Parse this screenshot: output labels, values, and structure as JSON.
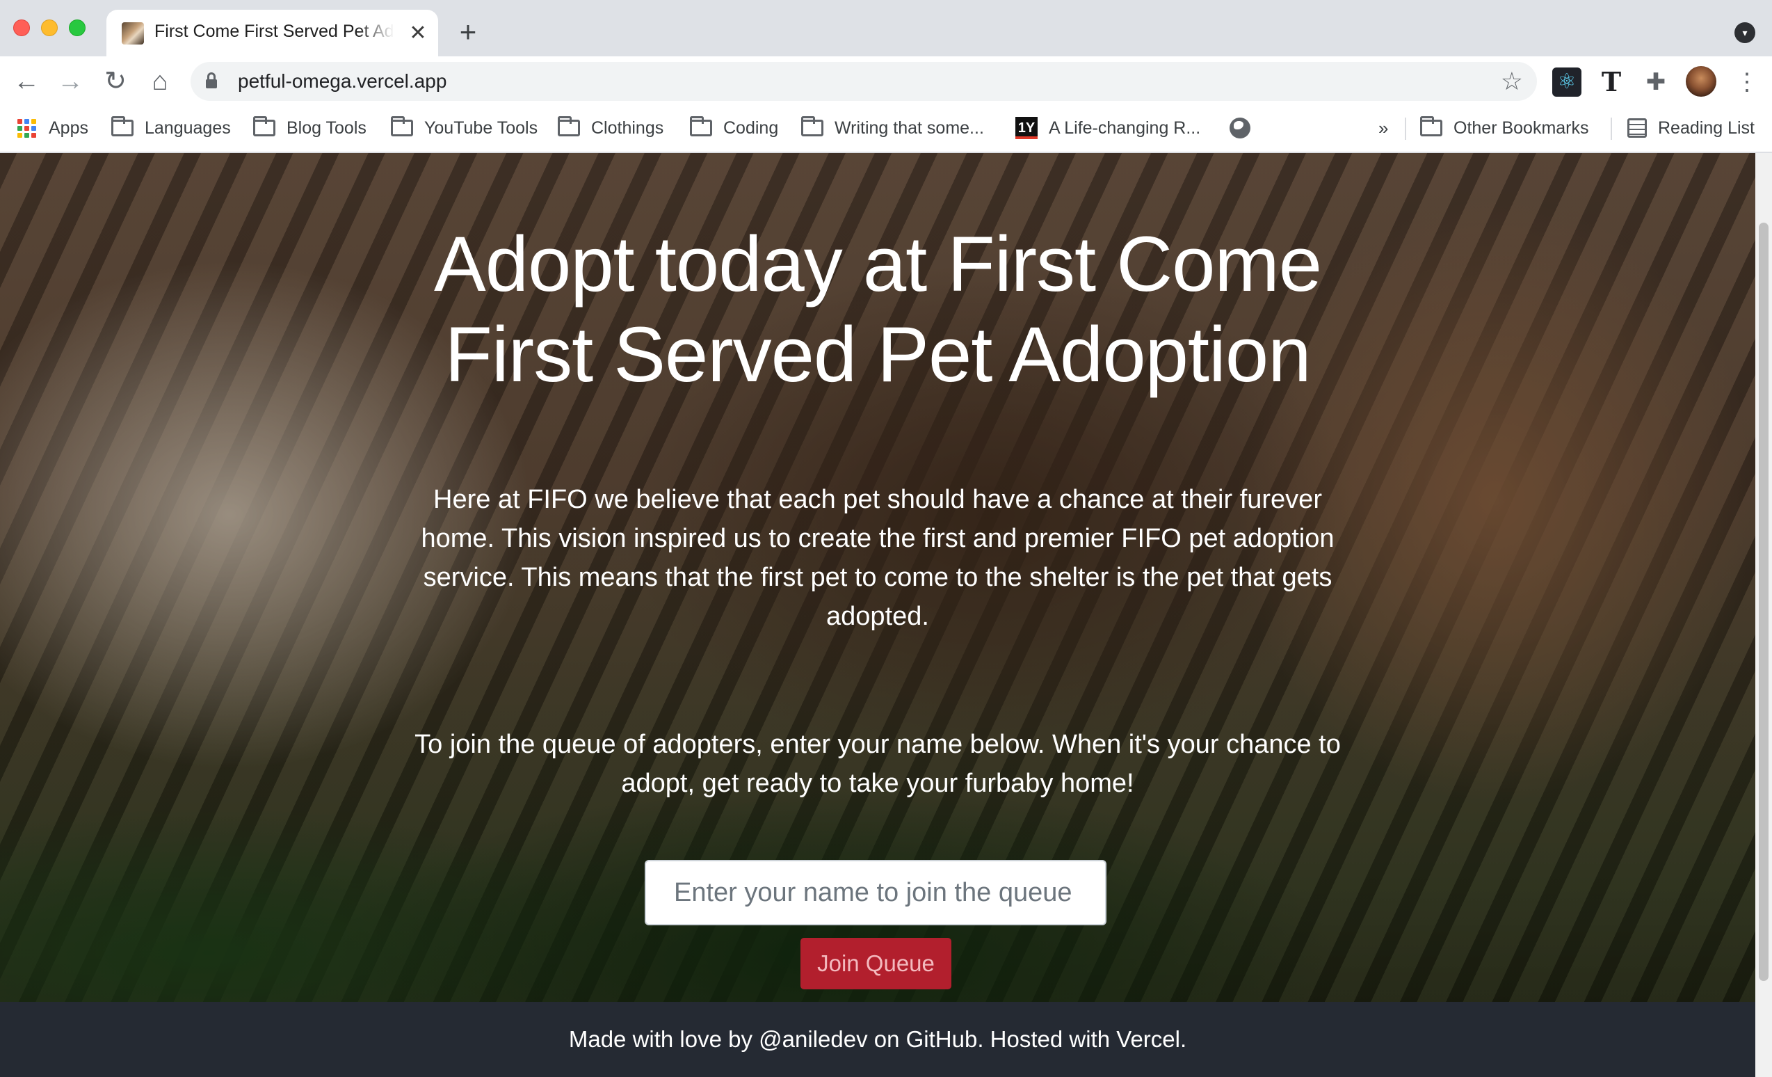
{
  "browser": {
    "tab": {
      "title": "First Come First Served Pet Adoption",
      "close_glyph": "✕"
    },
    "new_tab_glyph": "+",
    "nav": {
      "back_glyph": "←",
      "forward_glyph": "→",
      "reload_glyph": "↻",
      "home_glyph": "⌂"
    },
    "address_bar": {
      "url": "petful-omega.vercel.app",
      "bookmark_star_glyph": "☆"
    },
    "extensions": {
      "react_glyph": "⚛",
      "text_glyph": "T",
      "puzzle_glyph": "✚"
    },
    "menu_glyph": "⋮",
    "bookmarks": {
      "apps_label": "Apps",
      "items": [
        "Languages",
        "Blog Tools",
        "YouTube Tools",
        "Clothings",
        "Coding",
        "Writing that some...",
        "A Life-changing R..."
      ],
      "life_changing_icon_text": "1Y",
      "overflow_glyph": "»",
      "other_bookmarks": "Other Bookmarks",
      "reading_list": "Reading List"
    }
  },
  "page": {
    "hero_title": "Adopt today at First Come First Served Pet Adoption",
    "intro_paragraph": "Here at FIFO we believe that each pet should have a chance at their furever home. This vision inspired us to create the first and premier FIFO pet adoption service. This means that the first pet to come to the shelter is the pet that gets adopted.",
    "queue_paragraph": "To join the queue of adopters, enter your name below. When it's your chance to adopt, get ready to take your furbaby home!",
    "name_input": {
      "placeholder": "Enter your name to join the queue",
      "value": ""
    },
    "join_button_label": "Join Queue",
    "footer_text": "Made with love by @aniledev on GitHub. Hosted with Vercel."
  },
  "colors": {
    "join_button": "#b21f2d",
    "footer_bg": "#252a33",
    "tab_strip": "#dee1e6"
  },
  "icons": {
    "apps": "apps-grid-icon",
    "folder": "folder-icon",
    "globe": "globe-icon",
    "lock": "lock-icon",
    "star": "star-icon",
    "reading_list": "reading-list-icon"
  }
}
